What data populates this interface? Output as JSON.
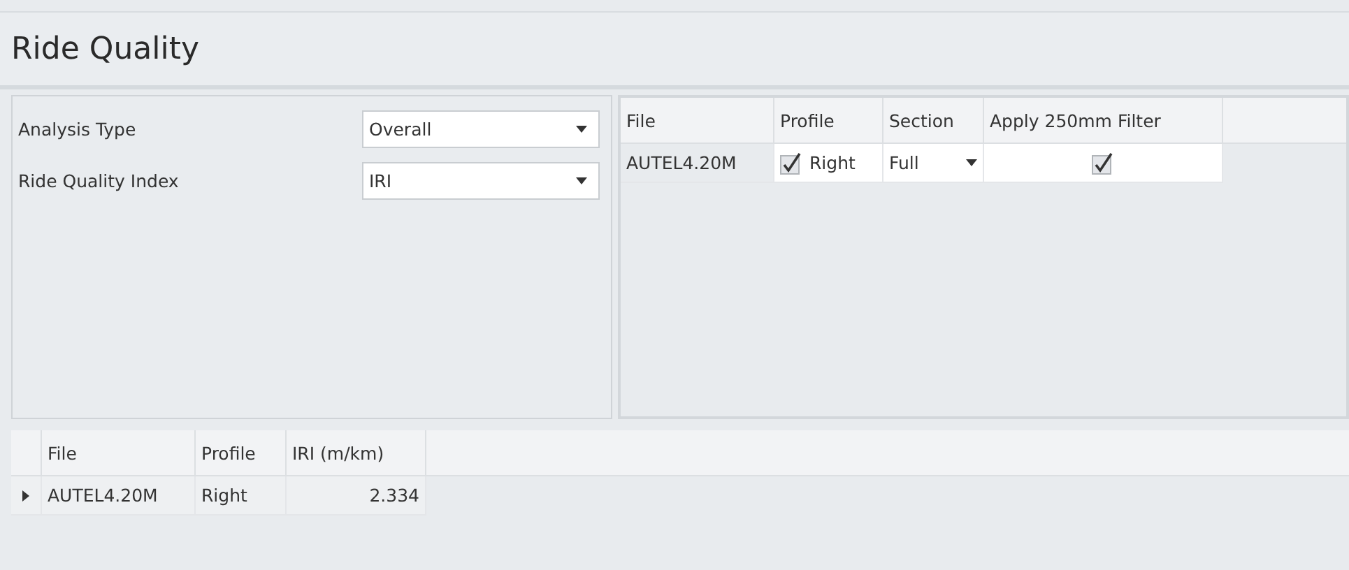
{
  "title": "Ride Quality",
  "settings": [
    {
      "label": "Analysis Type",
      "value": "Overall"
    },
    {
      "label": "Ride Quality Index",
      "value": "IRI"
    }
  ],
  "files_grid": {
    "columns": [
      "File",
      "Profile",
      "Section",
      "Apply 250mm Filter"
    ],
    "rows": [
      {
        "file": "AUTEL4.20M",
        "profile_checked": true,
        "profile": "Right",
        "section": "Full",
        "filter_checked": true
      }
    ]
  },
  "results_grid": {
    "columns": [
      "File",
      "Profile",
      "IRI (m/km)"
    ],
    "rows": [
      {
        "selected": true,
        "file": "AUTEL4.20M",
        "profile": "Right",
        "iri": "2.334"
      }
    ]
  }
}
